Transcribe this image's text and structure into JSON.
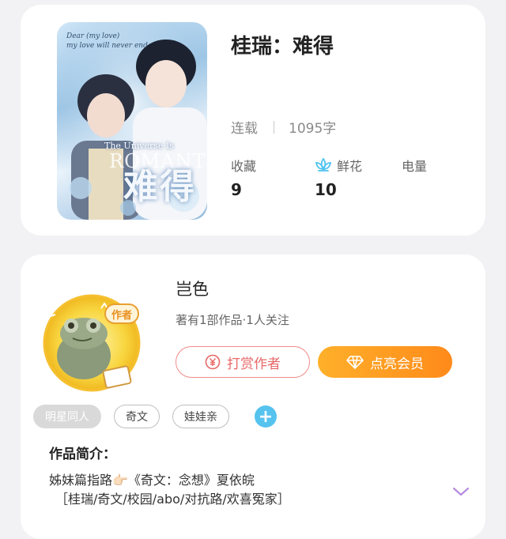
{
  "book": {
    "title": "桂瑞：难得",
    "cover": {
      "script": "Dear (my love)",
      "script2": "my love will never end",
      "subtitle": "The Universe Is",
      "roman": "ROMANTIC",
      "title_text": "难得"
    },
    "status": "连载",
    "word_count": "1095字",
    "stats": {
      "collect_label": "收藏",
      "collect_value": "9",
      "flower_label": "鲜花",
      "flower_value": "10",
      "power_label": "电量"
    }
  },
  "author": {
    "name": "岂色",
    "badge": "作者",
    "meta": "著有1部作品·1人关注",
    "tip_label": "打赏作者",
    "vip_label": "点亮会员",
    "tags": [
      "明星同人",
      "奇文",
      "娃娃亲"
    ],
    "add_tag": "+",
    "intro_heading": "作品简介：",
    "intro_line1": "姊妹篇指路👉🏻《奇文：念想》夏依皖",
    "intro_line2": "［桂瑞/奇文/校园/abo/对抗路/欢喜冤家］"
  },
  "colors": {
    "accent_orange": "#ff9a1f",
    "tip_red": "#e86868",
    "flower_blue": "#4cc3ee",
    "tag_plus": "#56c3ef",
    "expand_purple": "#b58be0"
  },
  "icons": {
    "flower": "lotus-icon",
    "tip": "yen-coin-icon",
    "vip": "diamond-icon",
    "expand": "chevron-down-icon"
  }
}
